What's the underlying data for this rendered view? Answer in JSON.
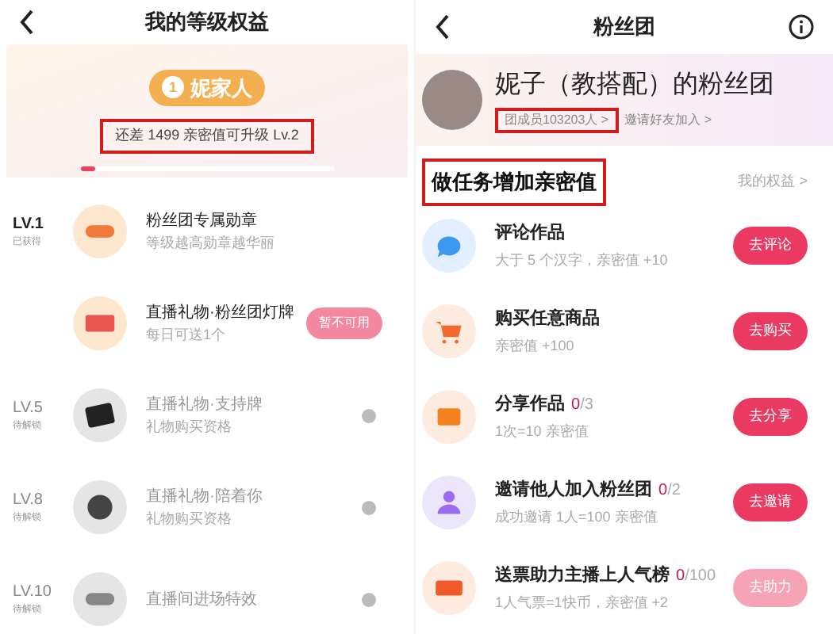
{
  "left": {
    "title": "我的等级权益",
    "banner": {
      "level_number": "1",
      "level_name": "妮家人",
      "hint": "还差 1499 亲密值可升级 Lv.2",
      "hint_highlighted": true,
      "level": 0.06
    },
    "perks": [
      {
        "level": "LV.1",
        "status": "已获得",
        "kind": "unlocked",
        "title": "粉丝团专属勋章",
        "desc": "等级越高勋章越华丽"
      },
      {
        "kind": "unlocked",
        "title": "直播礼物·粉丝团灯牌",
        "desc": "每日可送1个",
        "button": "暂不可用"
      },
      {
        "level": "LV.5",
        "status": "待解锁",
        "kind": "locked",
        "title": "直播礼物·支持牌",
        "desc": "礼物购买资格"
      },
      {
        "level": "LV.8",
        "status": "待解锁",
        "kind": "locked",
        "title": "直播礼物·陪着你",
        "desc": "礼物购买资格"
      },
      {
        "level": "LV.10",
        "status": "待解锁",
        "kind": "locked",
        "title": "直播间进场特效"
      }
    ]
  },
  "right": {
    "title": "粉丝团",
    "profile": {
      "name": "妮子（教搭配）的粉丝团",
      "members": "团成员103203人 >",
      "members_highlighted": true,
      "invite": "邀请好友加入 >"
    },
    "section": {
      "title": "做任务增加亲密值",
      "title_highlighted": true,
      "link": "我的权益 >"
    },
    "tasks": [
      {
        "title": "评论作品",
        "desc": "大于 5 个汉字，亲密值 +10",
        "button": "去评论",
        "disabled": false
      },
      {
        "title": "购买任意商品",
        "desc": "亲密值 +100",
        "button": "去购买",
        "disabled": false
      },
      {
        "title": "分享作品",
        "done": "0",
        "total": "/3",
        "desc": "1次=10 亲密值",
        "button": "去分享",
        "disabled": false
      },
      {
        "title": "邀请他人加入粉丝团",
        "done": "0",
        "total": "/2",
        "desc": "成功邀请 1人=100 亲密值",
        "button": "去邀请",
        "disabled": false
      },
      {
        "title": "送票助力主播上人气榜",
        "done": "0",
        "total": "/100",
        "desc": "1人气票=1快币，亲密值 +2",
        "button": "去助力",
        "disabled": true
      }
    ]
  }
}
